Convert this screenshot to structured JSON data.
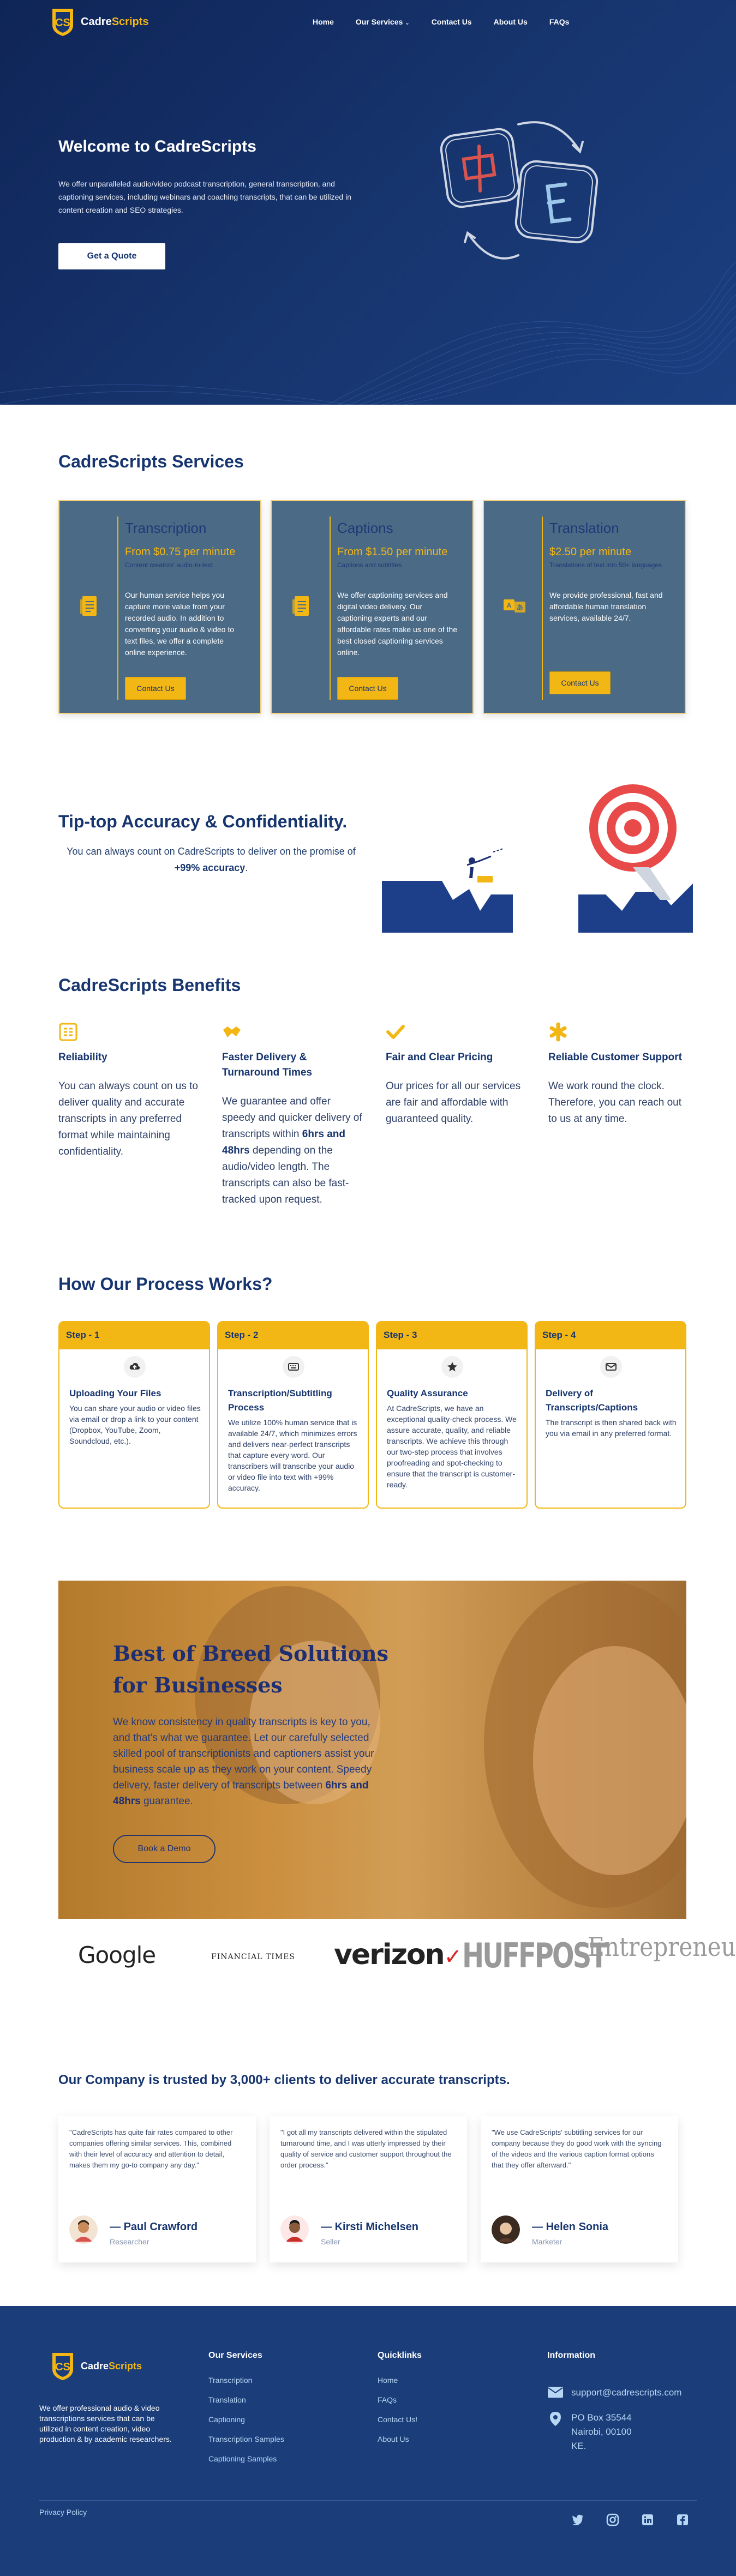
{
  "brand": {
    "name_main": "Cadre",
    "name_accent": "Scripts",
    "accent_color": "#f2b615",
    "navy_color": "#17356f"
  },
  "nav": {
    "items": [
      {
        "label": "Home"
      },
      {
        "label": "Our Services"
      },
      {
        "label": "Contact Us"
      },
      {
        "label": "About Us"
      },
      {
        "label": "FAQs"
      }
    ],
    "dropdown_icon": "chevron-down-icon"
  },
  "hero": {
    "title": "Welcome to CadreScripts",
    "text": "We offer unparalleled audio/video podcast transcription, general transcription, and captioning services, including webinars and coaching transcripts, that can be utilized in content creation and SEO strategies.",
    "button": "Get a Quote"
  },
  "services": {
    "title": "CadreScripts Services",
    "cards": [
      {
        "title": "Transcription",
        "price": "From $0.75 per minute",
        "sub": "Content creators' audio-to-text",
        "desc": "Our human service helps you capture more value from your recorded audio. In addition to converting your audio & video to text files, we offer a complete online experience.",
        "button": "Contact Us",
        "icon": "document-icon"
      },
      {
        "title": "Captions",
        "price": "From $1.50 per minute",
        "sub": "Captions and subtitles",
        "desc": "We offer captioning services and digital video delivery. Our captioning experts and our affordable rates make us one of the best closed captioning services online.",
        "button": "Contact Us",
        "icon": "document-icon"
      },
      {
        "title": "Translation",
        "price": "$2.50 per minute",
        "sub": "Translations of text into 50+ languages",
        "desc": "We provide professional, fast and affordable human translation services, available 24/7.",
        "button": "Contact Us",
        "icon": "translate-icon"
      }
    ]
  },
  "accuracy": {
    "title": "Tip-top Accuracy & Confidentiality.",
    "text_before": "You can always count on CadreScripts to deliver on the promise of ",
    "text_bold": "+99% accuracy",
    "text_after": "."
  },
  "benefits": {
    "title": "CadreScripts Benefits",
    "items": [
      {
        "title": "Reliability",
        "text": "You can always count on us to deliver quality and accurate transcripts in any preferred format while maintaining confidentiality.",
        "icon": "grid-icon"
      },
      {
        "title": "Faster Delivery & Turnaround Times",
        "text_before": "We guarantee and offer speedy and quicker delivery of transcripts within ",
        "text_bold": "6hrs and 48hrs",
        "text_after": " depending on the audio/video length. The transcripts can also be fast-tracked upon request.",
        "icon": "handshake-icon"
      },
      {
        "title": "Fair and Clear Pricing",
        "text": "Our prices for all our services are fair and affordable with guaranteed quality.",
        "icon": "check-icon"
      },
      {
        "title": "Reliable Customer Support",
        "text": "We work round the clock. Therefore, you can reach out to us at any time.",
        "icon": "asterisk-icon"
      }
    ]
  },
  "process": {
    "title": "How Our Process Works?",
    "steps": [
      {
        "label": "Step - 1",
        "title": "Uploading Your Files",
        "text": "You can share your audio or video files via email or drop a link to your content (Dropbox, YouTube, Zoom, Soundcloud, etc.).",
        "icon": "cloud-upload-icon"
      },
      {
        "label": "Step - 2",
        "title": "Transcription/Subtitling Process",
        "text": "We utilize 100% human service that is available 24/7, which minimizes errors and delivers near-perfect transcripts that capture every word. Our transcribers will transcribe your audio or video file into text with +99% accuracy.",
        "icon": "keyboard-icon"
      },
      {
        "label": "Step - 3",
        "title": "Quality Assurance",
        "text": "At CadreScripts, we have an exceptional quality-check process. We assure accurate, quality, and reliable transcripts. We achieve this through our two-step process that involves proofreading and spot-checking to ensure that the transcript is customer-ready.",
        "icon": "star-icon"
      },
      {
        "label": "Step - 4",
        "title": "Delivery of Transcripts/Captions",
        "text": "The transcript is then shared back with you via email in any preferred format.",
        "icon": "envelope-icon"
      }
    ]
  },
  "breed": {
    "title": "Best of Breed Solutions for Businesses",
    "text_before": "We know consistency in quality transcripts is key to you, and that's what we guarantee. Let our carefully selected skilled pool of transcriptionists and captioners assist your business scale up as they work on your content. Speedy delivery, faster delivery of transcripts between ",
    "text_bold": "6hrs and 48hrs",
    "text_after": " guarantee.",
    "button": "Book a Demo"
  },
  "logos": [
    "Google",
    "FINANCIAL TIMES",
    "verizon",
    "HUFFPOST",
    "Entrepreneur"
  ],
  "trust": {
    "title": "Our Company is trusted by 3,000+ clients to deliver accurate transcripts.",
    "testimonials": [
      {
        "quote": "\"CadreScripts has quite fair rates compared to other companies offering similar services. This, combined with their level of accuracy and attention to detail, makes them my go-to company any day.\"",
        "name": "Paul Crawford",
        "role": "Researcher"
      },
      {
        "quote": "\"I got all my transcripts delivered within the stipulated turnaround time, and I was utterly impressed by their quality of service and customer support throughout the order process.\"",
        "name": "Kirsti Michelsen",
        "role": "Seller"
      },
      {
        "quote": "\"We use CadreScripts' subtitling services for our company because they do good work with the syncing of the videos and the various caption format options that they offer afterward.\"",
        "name": "Helen Sonia",
        "role": "Marketer"
      }
    ]
  },
  "footer": {
    "about": "We offer professional audio & video transcriptions services that can be utilized in content creation, video production & by academic researchers.",
    "services_title": "Our Services",
    "services": [
      "Transcription",
      "Translation",
      "Captioning",
      "Transcription Samples",
      "Captioning Samples"
    ],
    "quick_title": "Quicklinks",
    "quick": [
      "Home",
      "FAQs",
      "Contact Us!",
      "About Us"
    ],
    "info_title": "Information",
    "email": "support@cadrescripts.com",
    "address": [
      "PO Box 35544",
      "Nairobi, 00100",
      "KE."
    ],
    "privacy": "Privacy Policy",
    "social": [
      "twitter-icon",
      "instagram-icon",
      "linkedin-icon",
      "facebook-icon"
    ]
  }
}
